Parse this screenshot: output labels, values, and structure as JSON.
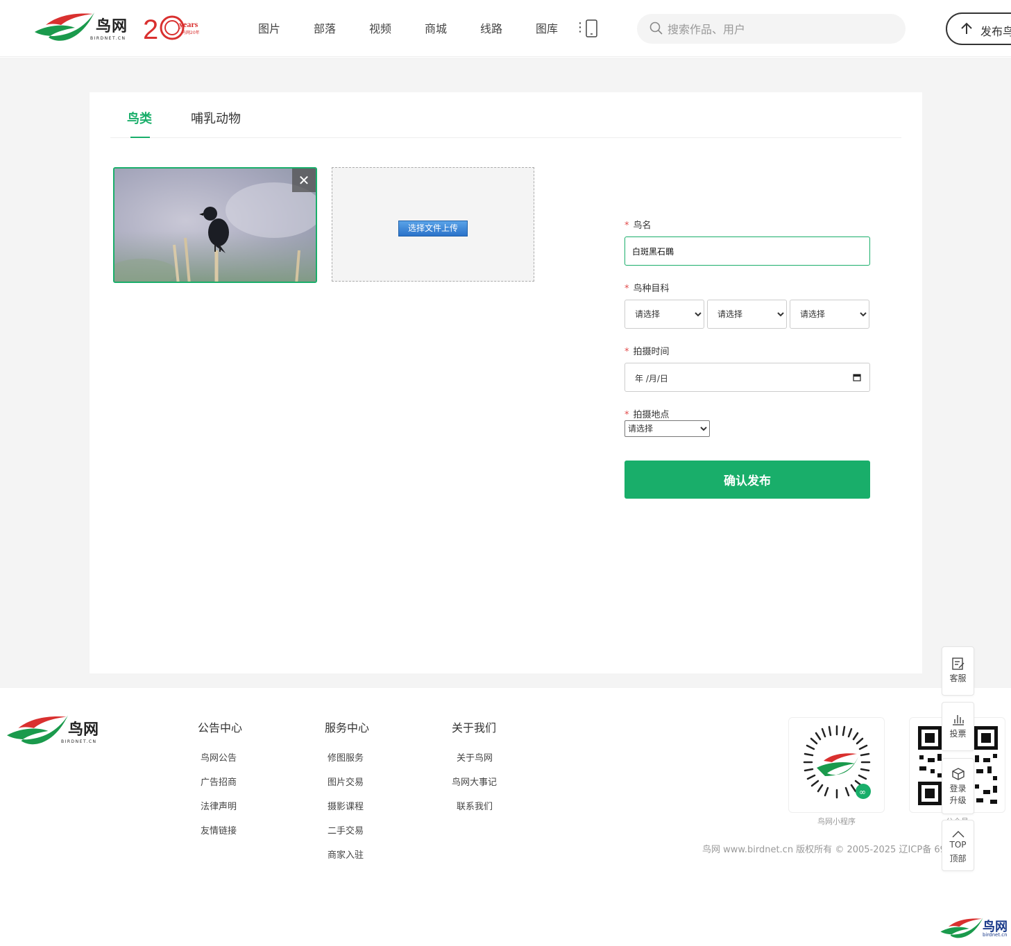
{
  "header": {
    "logo_text": "鸟网",
    "logo_sub": "BIRDNET.CN",
    "years_badge": "years",
    "years_sub": "鸟网20年",
    "nav": [
      "图片",
      "部落",
      "视频",
      "商城",
      "线路",
      "图库"
    ],
    "more_icon": "⋮",
    "search_placeholder": "搜索作品、用户",
    "publish_label": "发布鸟"
  },
  "tabs": [
    {
      "label": "鸟类",
      "active": true
    },
    {
      "label": "哺乳动物",
      "active": false
    }
  ],
  "upload": {
    "close": "✕",
    "button_label": "选择文件上传"
  },
  "form": {
    "bird_name_label": "鸟名",
    "bird_name_value": "白斑黑石䳭",
    "family_label": "鸟种目科",
    "select_placeholder": "请选择",
    "time_label": "拍摄时间",
    "date_placeholder": "年 /月/日",
    "location_label": "拍摄地点",
    "required_mark": "*",
    "submit_label": "确认发布"
  },
  "footer": {
    "logo_text": "鸟网",
    "logo_sub": "BIRDNET.CN",
    "columns": [
      {
        "title": "公告中心",
        "links": [
          "鸟网公告",
          "广告招商",
          "法律声明",
          "友情链接"
        ]
      },
      {
        "title": "服务中心",
        "links": [
          "修图服务",
          "图片交易",
          "摄影课程",
          "二手交易",
          "商家入驻"
        ]
      },
      {
        "title": "关于我们",
        "links": [
          "关于鸟网",
          "鸟网大事记",
          "联系我们"
        ]
      }
    ],
    "qr_captions": [
      "鸟网小程序",
      "公众号"
    ],
    "copyright": "鸟网 www.birdnet.cn 版权所有 © 2005-2025 辽ICP备            69号-1",
    "corner_text": "鸟网",
    "corner_sub": "birdnet.cn"
  },
  "float_bar": {
    "service": "客服",
    "vote": "投票",
    "login_line1": "登录",
    "login_line2": "升级",
    "top_en": "TOP",
    "top_cn": "顶部"
  },
  "colors": {
    "accent": "#19ae6a",
    "required": "#e24c4c",
    "upload_button": "#2a72c9"
  }
}
